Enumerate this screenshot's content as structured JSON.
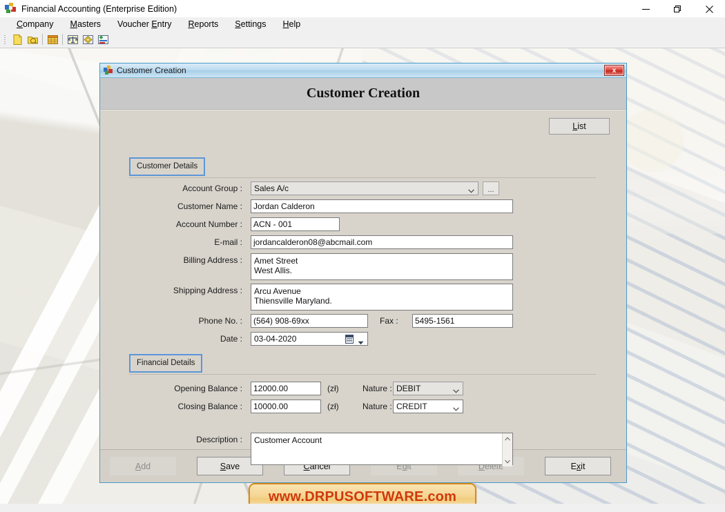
{
  "app": {
    "title": "Financial Accounting (Enterprise Edition)",
    "icon": "app-puzzle-icon",
    "window_controls": {
      "minimize": "minimize-icon",
      "restore": "restore-icon",
      "close": "close-icon"
    },
    "menus": [
      {
        "label": "Company",
        "accel": "C"
      },
      {
        "label": "Masters",
        "accel": "M"
      },
      {
        "label": "Voucher Entry",
        "accel": "E"
      },
      {
        "label": "Reports",
        "accel": "R"
      },
      {
        "label": "Settings",
        "accel": "S"
      },
      {
        "label": "Help",
        "accel": "H"
      }
    ],
    "toolbar": [
      {
        "name": "new-company-icon"
      },
      {
        "name": "open-company-icon"
      },
      {
        "name": "ledger-table-icon"
      },
      {
        "name": "trial-balance-icon"
      },
      {
        "name": "voucher-icon"
      },
      {
        "name": "reports-chart-icon"
      }
    ]
  },
  "dialog": {
    "titlebar_text": "Customer Creation",
    "close_label": "x",
    "heading": "Customer Creation",
    "list_button": "List",
    "groups": {
      "customer_details": "Customer Details",
      "financial_details": "Financial Details"
    },
    "fields": {
      "account_group": {
        "label": "Account Group :",
        "value": "Sales A/c",
        "browse": "..."
      },
      "customer_name": {
        "label": "Customer Name :",
        "value": "Jordan Calderon"
      },
      "account_number": {
        "label": "Account Number :",
        "value": "ACN - 001"
      },
      "email": {
        "label": "E-mail :",
        "value": "jordancalderon08@abcmail.com"
      },
      "billing_address": {
        "label": "Billing Address :",
        "value": "Amet Street\nWest Allis."
      },
      "shipping_address": {
        "label": "Shipping Address :",
        "value": "Arcu Avenue\nThiensville Maryland."
      },
      "phone": {
        "label": "Phone No. :",
        "value": "(564) 908-69xx"
      },
      "fax": {
        "label": "Fax :",
        "value": "5495-1561"
      },
      "date": {
        "label": "Date :",
        "value": "03-04-2020"
      },
      "opening_balance": {
        "label": "Opening Balance :",
        "value": "12000.00",
        "currency": "(zł)"
      },
      "closing_balance": {
        "label": "Closing Balance :",
        "value": "10000.00",
        "currency": "(zł)"
      },
      "opening_nature": {
        "label": "Nature :",
        "value": "DEBIT"
      },
      "closing_nature": {
        "label": "Nature :",
        "value": "CREDIT"
      },
      "description": {
        "label": "Description :",
        "value": "Customer Account"
      }
    },
    "buttons": [
      {
        "label": "Add",
        "accel": "A",
        "enabled": false
      },
      {
        "label": "Save",
        "accel": "S",
        "enabled": true
      },
      {
        "label": "Cancel",
        "accel": "C",
        "enabled": true
      },
      {
        "label": "Edit",
        "accel": "d",
        "enabled": false
      },
      {
        "label": "Delete",
        "accel": "D",
        "enabled": false
      },
      {
        "label": "Exit",
        "accel": "x",
        "enabled": true
      }
    ]
  },
  "watermark": {
    "text": "www.DRPUSOFTWARE.com"
  },
  "colors": {
    "dialog_border": "#4a9bc7",
    "group_chip_border": "#5b96d8",
    "close_button": "#c3251c",
    "watermark_text": "#cf3a0c",
    "watermark_border": "#d98a18"
  }
}
